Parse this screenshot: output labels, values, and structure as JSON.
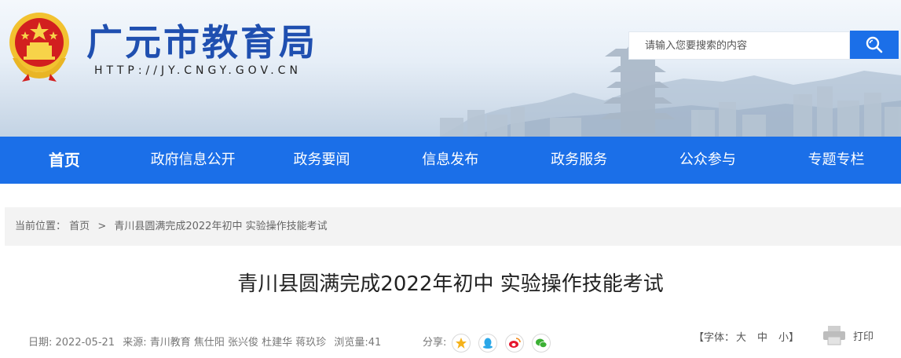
{
  "header": {
    "title": "广元市教育局",
    "url": "HTTP://JY.CNGY.GOV.CN",
    "search_placeholder": "请输入您要搜索的内容",
    "emblem": "national-emblem"
  },
  "nav": {
    "items": [
      {
        "label": "首页",
        "active": true
      },
      {
        "label": "政府信息公开"
      },
      {
        "label": "政务要闻"
      },
      {
        "label": "信息发布"
      },
      {
        "label": "政务服务"
      },
      {
        "label": "公众参与"
      },
      {
        "label": "专题专栏"
      }
    ]
  },
  "breadcrumb": {
    "prefix": "当前位置：",
    "home": "首页",
    "separator": ">",
    "current": "青川县圆满完成2022年初中 实验操作技能考试"
  },
  "article": {
    "title": "青川县圆满完成2022年初中 实验操作技能考试",
    "date": "日期: 2022-05-21",
    "source": "来源: 青川教育 焦仕阳 张兴俊 杜建华 蒋玖珍",
    "views": "浏览量:41"
  },
  "share": {
    "label": "分享:",
    "icons": [
      "qzone-icon",
      "qq-icon",
      "weibo-icon",
      "wechat-icon"
    ]
  },
  "font_size": {
    "open": "【字体：",
    "large": "大",
    "medium": "中",
    "small": "小",
    "close": "】"
  },
  "print": {
    "label": "打印"
  },
  "colors": {
    "primary": "#1b6fe8",
    "title_blue": "#1f4fb0"
  }
}
